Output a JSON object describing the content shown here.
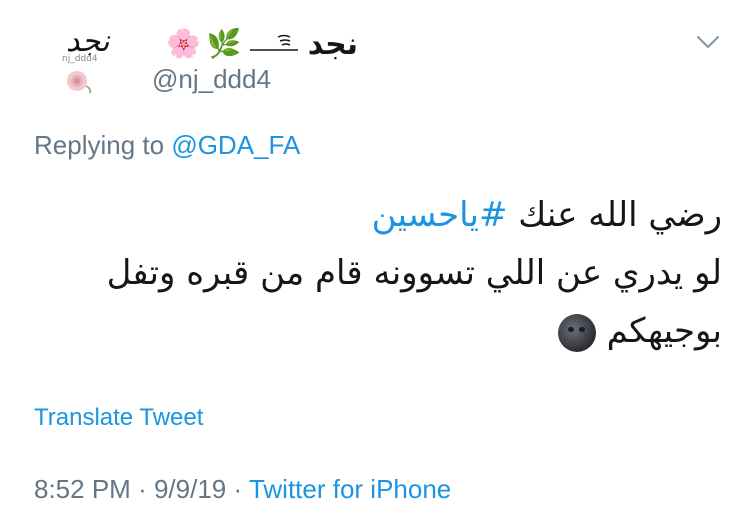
{
  "tweet": {
    "author_name": "نجد",
    "author_emojis": [
      "🌸",
      "🌿"
    ],
    "author_flourish": "≋",
    "avatar_text": "نجد",
    "avatar_small_text": "nj_ddd4",
    "handle": "@nj_ddd4",
    "replying_prefix": "Replying to",
    "replying_to": "@GDA_FA",
    "body": {
      "line1_text": "رضي الله عنك",
      "line1_hashtag": "#ياحسين",
      "line2": "لو يدري عن اللي تسوونه قام من قبره وتفل",
      "line3_text": "بوجيهكم",
      "line3_emoji": "new-moon-face-emoji"
    },
    "translate_label": "Translate Tweet",
    "time": "8:52 PM",
    "date": "9/9/19",
    "separator": "·",
    "source": "Twitter for iPhone"
  },
  "colors": {
    "link": "#1b95e0",
    "secondary": "#657786",
    "text": "#14171a"
  }
}
